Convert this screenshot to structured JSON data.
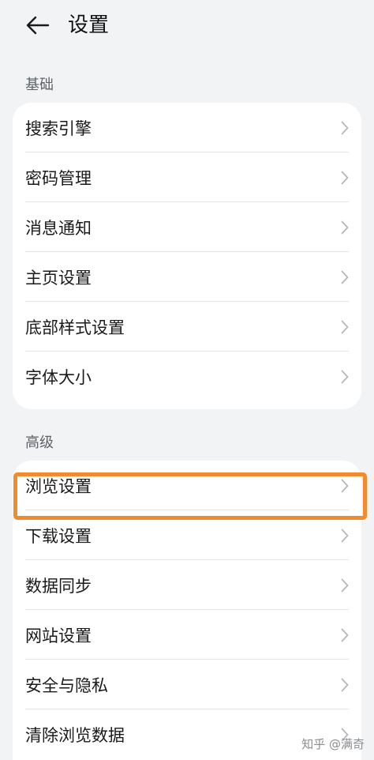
{
  "header": {
    "title": "设置"
  },
  "sections": [
    {
      "label": "基础",
      "items": [
        {
          "label": "搜索引擎"
        },
        {
          "label": "密码管理"
        },
        {
          "label": "消息通知"
        },
        {
          "label": "主页设置"
        },
        {
          "label": "底部样式设置"
        },
        {
          "label": "字体大小"
        }
      ]
    },
    {
      "label": "高级",
      "items": [
        {
          "label": "浏览设置"
        },
        {
          "label": "下载设置"
        },
        {
          "label": "数据同步"
        },
        {
          "label": "网站设置"
        },
        {
          "label": "安全与隐私"
        },
        {
          "label": "清除浏览数据"
        }
      ]
    }
  ],
  "watermark": "知乎 @满奇",
  "colors": {
    "background": "#f1f3f5",
    "card": "#ffffff",
    "highlight": "#f28a2e",
    "chevron": "#b5b7ba"
  },
  "icons": {
    "back": "arrow-left-icon",
    "row_chevron": "chevron-right-icon"
  }
}
